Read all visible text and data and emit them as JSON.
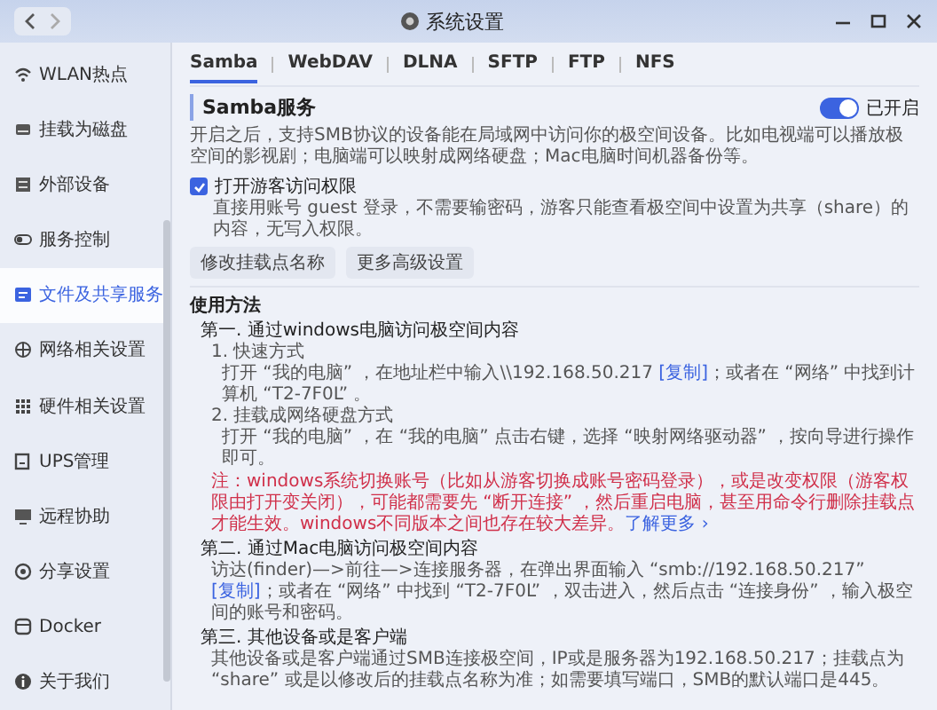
{
  "window": {
    "title": "系统设置"
  },
  "sidebar": {
    "items": [
      {
        "label": "WLAN热点",
        "selected": false
      },
      {
        "label": "挂载为磁盘",
        "selected": false
      },
      {
        "label": "外部设备",
        "selected": false
      },
      {
        "label": "服务控制",
        "selected": false
      },
      {
        "label": "文件及共享服务",
        "selected": true
      },
      {
        "label": "网络相关设置",
        "selected": false
      },
      {
        "label": "硬件相关设置",
        "selected": false
      },
      {
        "label": "UPS管理",
        "selected": false
      },
      {
        "label": "远程协助",
        "selected": false
      },
      {
        "label": "分享设置",
        "selected": false
      },
      {
        "label": "Docker",
        "selected": false
      },
      {
        "label": "关于我们",
        "selected": false
      }
    ]
  },
  "tabs": [
    {
      "label": "Samba",
      "selected": true
    },
    {
      "label": "WebDAV",
      "selected": false
    },
    {
      "label": "DLNA",
      "selected": false
    },
    {
      "label": "SFTP",
      "selected": false
    },
    {
      "label": "FTP",
      "selected": false
    },
    {
      "label": "NFS",
      "selected": false
    }
  ],
  "service": {
    "title": "Samba服务",
    "toggle": {
      "on": true,
      "label": "已开启"
    },
    "description": "开启之后，支持SMB协议的设备能在局域网中访问你的极空间设备。比如电视端可以播放极空间的影视剧；电脑端可以映射成网络硬盘；Mac电脑时间机器备份等。",
    "guest": {
      "label": "打开游客访问权限",
      "checked": true,
      "hint": "直接用账号 guest 登录，不需要输密码，游客只能查看极空间中设置为共享（share）的内容，无写入权限。"
    },
    "buttons": [
      "修改挂载点名称",
      "更多高级设置"
    ]
  },
  "usage": {
    "title": "使用方法",
    "blocks": [
      {
        "kind": "heading",
        "text": "第一. 通过windows电脑访问极空间内容"
      },
      {
        "kind": "step",
        "text": "1. 快速方式"
      },
      {
        "kind": "indent",
        "parts": [
          {
            "kind": "text",
            "text": "打开 “我的电脑” ，在地址栏中输入\\\\192.168.50.217 "
          },
          {
            "kind": "link",
            "text": "[复制]"
          },
          {
            "kind": "text",
            "text": "；或者在 “网络” 中找到计算机 “T2-7F0L” 。"
          }
        ]
      },
      {
        "kind": "step",
        "text": "2. 挂载成网络硬盘方式"
      },
      {
        "kind": "indent",
        "parts": [
          {
            "kind": "text",
            "text": "打开 “我的电脑” ，在 “我的电脑” 点击右键，选择 “映射网络驱动器” ，按向导进行操作即可。"
          }
        ]
      },
      {
        "kind": "warning",
        "parts": [
          {
            "kind": "text",
            "text": "注：windows系统切换账号（比如从游客切换成账号密码登录），或是改变权限（游客权限由打开变关闭），可能都需要先 “断开连接” ，然后重启电脑，甚至用命令行删除挂载点才能生效。windows不同版本之间也存在较大差异。"
          },
          {
            "kind": "link",
            "text": "了解更多 ›"
          }
        ]
      },
      {
        "kind": "heading",
        "text": "第二. 通过Mac电脑访问极空间内容"
      },
      {
        "kind": "body",
        "parts": [
          {
            "kind": "text",
            "text": "访达(finder)—>前往—>连接服务器，在弹出界面输入 “smb://192.168.50.217” "
          },
          {
            "kind": "link",
            "text": "[复制]"
          },
          {
            "kind": "text",
            "text": "；或者在 “网络” 中找到 “T2-7F0L” ，双击进入，然后点击 “连接身份” ，输入极空间的账号和密码。"
          }
        ]
      },
      {
        "kind": "heading",
        "text": "第三. 其他设备或是客户端"
      },
      {
        "kind": "body",
        "parts": [
          {
            "kind": "text",
            "text": "其他设备或是客户端通过SMB连接极空间，IP或是服务器为192.168.50.217；挂载点为 “share” 或是以修改后的挂载点名称为准；如需要填写端口，SMB的默认端口是445。"
          }
        ]
      }
    ]
  }
}
